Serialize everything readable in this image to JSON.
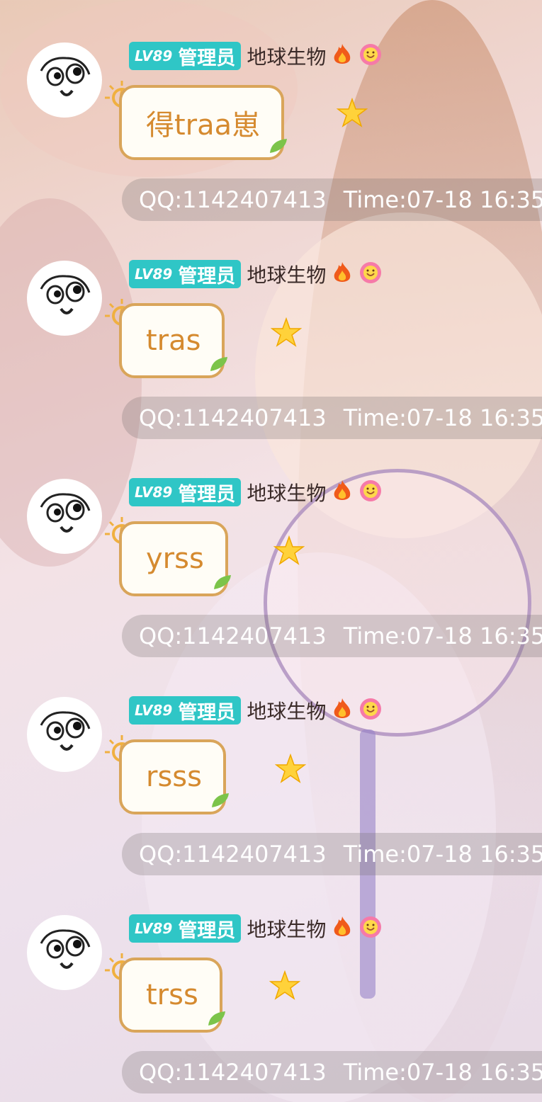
{
  "messages": [
    {
      "level": "LV89",
      "role": "管理员",
      "username": "地球生物",
      "text": "得traa崽",
      "qq": "QQ:1142407413",
      "time": "Time:07-18 16:35",
      "icons": [
        "fire-icon",
        "smile-face-icon"
      ]
    },
    {
      "level": "LV89",
      "role": "管理员",
      "username": "地球生物",
      "text": "tras",
      "qq": "QQ:1142407413",
      "time": "Time:07-18 16:35",
      "icons": [
        "fire-icon",
        "smile-face-icon"
      ]
    },
    {
      "level": "LV89",
      "role": "管理员",
      "username": "地球生物",
      "text": "yrss",
      "qq": "QQ:1142407413",
      "time": "Time:07-18 16:35",
      "icons": [
        "fire-icon",
        "smile-face-icon"
      ]
    },
    {
      "level": "LV89",
      "role": "管理员",
      "username": "地球生物",
      "text": "rsss",
      "qq": "QQ:1142407413",
      "time": "Time:07-18 16:35",
      "icons": [
        "fire-icon",
        "smile-face-icon"
      ]
    },
    {
      "level": "LV89",
      "role": "管理员",
      "username": "地球生物",
      "text": "trss",
      "qq": "QQ:1142407413",
      "time": "Time:07-18 16:35",
      "icons": [
        "fire-icon",
        "smile-face-icon"
      ]
    }
  ],
  "colors": {
    "level_badge": "#2fc6c6",
    "bubble_border": "#d9a55a",
    "bubble_text": "#d58a2f",
    "username_text": "#3a2a28"
  }
}
